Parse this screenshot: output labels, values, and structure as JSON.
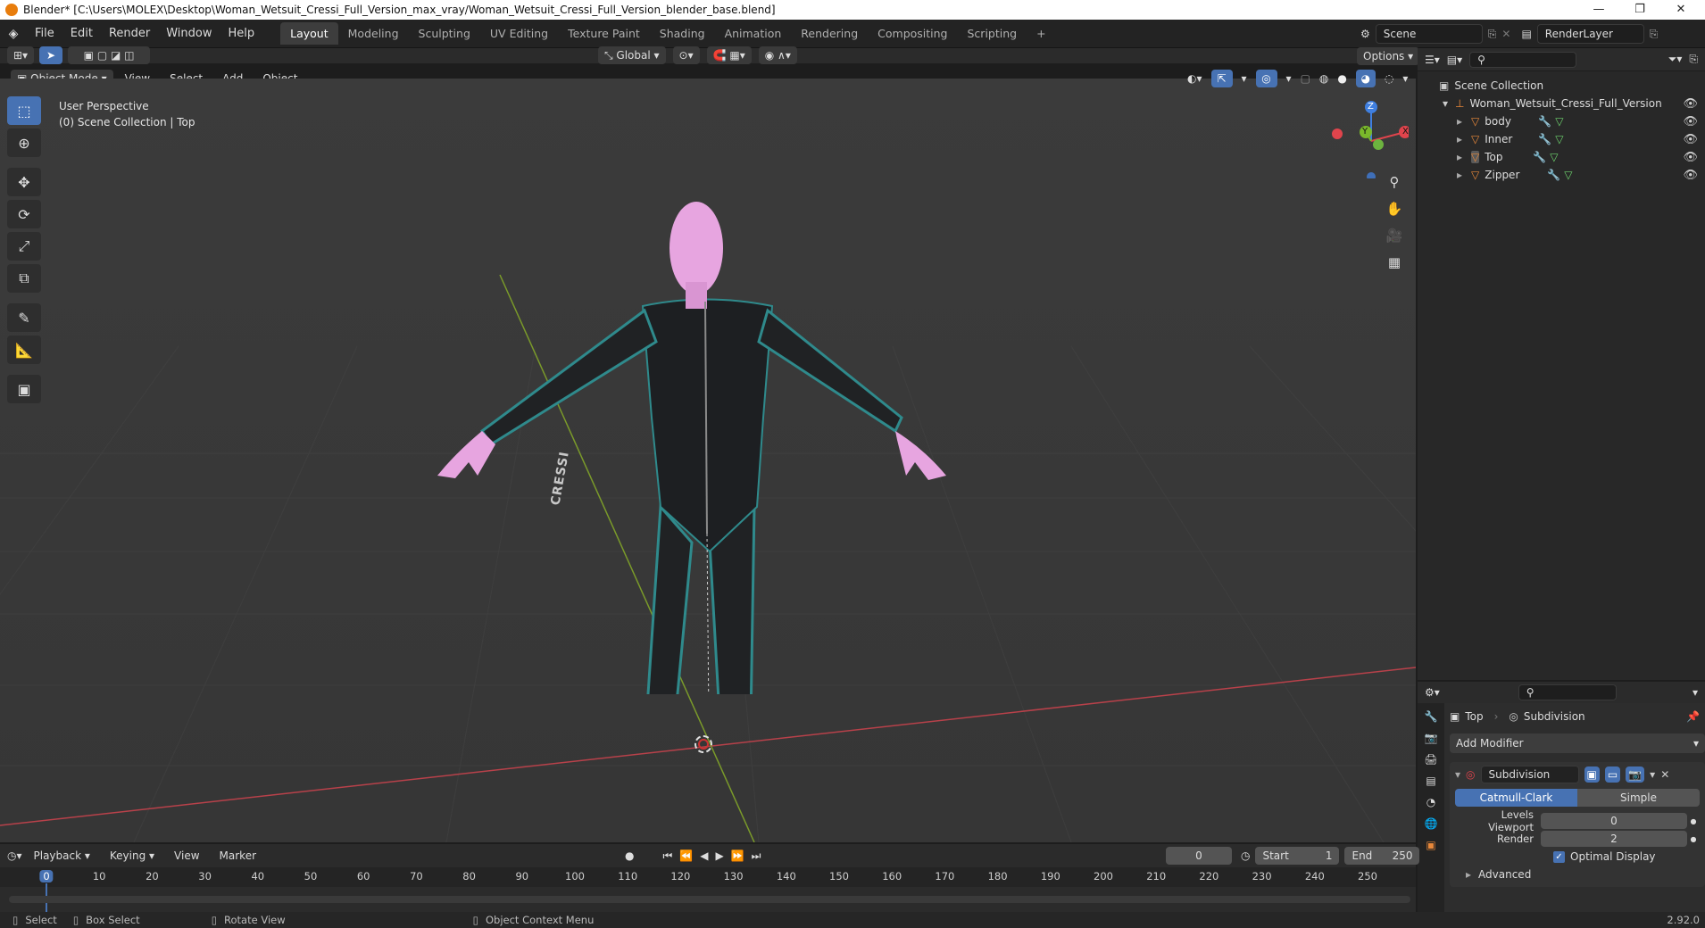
{
  "window": {
    "title": "Blender* [C:\\Users\\MOLEX\\Desktop\\Woman_Wetsuit_Cressi_Full_Version_max_vray/Woman_Wetsuit_Cressi_Full_Version_blender_base.blend]",
    "minimize": "—",
    "maximize": "❐",
    "close": "✕"
  },
  "menu": [
    "File",
    "Edit",
    "Render",
    "Window",
    "Help"
  ],
  "workspaces": [
    "Layout",
    "Modeling",
    "Sculpting",
    "UV Editing",
    "Texture Paint",
    "Shading",
    "Animation",
    "Rendering",
    "Compositing",
    "Scripting"
  ],
  "workspace_active": "Layout",
  "scene": {
    "name": "Scene",
    "render_layer": "RenderLayer"
  },
  "header": {
    "transform": "Global",
    "options": "Options",
    "mode": "Object Mode",
    "menus": [
      "View",
      "Select",
      "Add",
      "Object"
    ]
  },
  "viewport": {
    "overlay_line1": "User Perspective",
    "overlay_line2": "(0) Scene Collection | Top",
    "gizmo": {
      "z": "Z",
      "y": "Y",
      "x": "X"
    },
    "suit_brand": "CRESSI"
  },
  "outliner": {
    "root": "Scene Collection",
    "collection": "Woman_Wetsuit_Cressi_Full_Version",
    "items": [
      "body",
      "Inner",
      "Top",
      "Zipper"
    ]
  },
  "properties": {
    "object": "Top",
    "modifier_tab": "Subdivision",
    "add_modifier": "Add Modifier",
    "modifier_name": "Subdivision",
    "mode_a": "Catmull-Clark",
    "mode_b": "Simple",
    "levels_viewport_label": "Levels Viewport",
    "levels_viewport": "0",
    "render_label": "Render",
    "render_level": "2",
    "optimal_display": "Optimal Display",
    "advanced": "Advanced"
  },
  "timeline": {
    "menus": [
      "Playback",
      "Keying",
      "View",
      "Marker"
    ],
    "current_frame": "0",
    "start_label": "Start",
    "start": "1",
    "end_label": "End",
    "end": "250",
    "ticks": [
      "0",
      "10",
      "20",
      "30",
      "40",
      "50",
      "60",
      "70",
      "80",
      "90",
      "100",
      "110",
      "120",
      "130",
      "140",
      "150",
      "160",
      "170",
      "180",
      "190",
      "200",
      "210",
      "220",
      "230",
      "240",
      "250"
    ]
  },
  "status": {
    "select": "Select",
    "box_select": "Box Select",
    "rotate_view": "Rotate View",
    "context_menu": "Object Context Menu",
    "version": "2.92.0"
  },
  "colors": {
    "accent": "#4772b3",
    "object": "#e8883a",
    "x_axis": "#e0444c",
    "y_axis": "#7ab82b",
    "z_axis": "#3f7fe0"
  }
}
